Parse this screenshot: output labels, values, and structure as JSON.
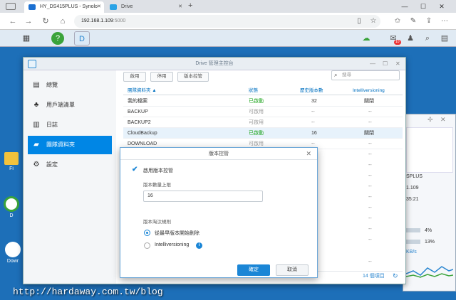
{
  "browser": {
    "tabs": [
      {
        "label": "HY_DS415PLUS - Synolo",
        "close": "✕"
      },
      {
        "label": "Drive",
        "close": "✕"
      }
    ],
    "new_tab": "+",
    "window_controls": {
      "minimize": "—",
      "maximize": "☐",
      "close": "✕"
    },
    "nav": {
      "back": "←",
      "forward": "→",
      "reload": "↻",
      "home": "⌂"
    },
    "url": {
      "host": "192.168.1.109",
      "port": ":5000"
    }
  },
  "dsm_taskbar": {
    "notification_count": "10"
  },
  "desktop_icons": [
    {
      "label": "Fi"
    },
    {
      "label": "D"
    },
    {
      "label": "Dowr"
    }
  ],
  "window": {
    "title": "Drive 管理主控台",
    "controls": {
      "minimize": "—",
      "maximize": "☐",
      "close": "✕"
    }
  },
  "sidebar": {
    "items": [
      {
        "label": "總覽",
        "icon": "overview-icon"
      },
      {
        "label": "用戶端清單",
        "icon": "client-list-icon"
      },
      {
        "label": "日誌",
        "icon": "log-icon"
      },
      {
        "label": "團隊資料夾",
        "icon": "team-folder-icon"
      },
      {
        "label": "設定",
        "icon": "settings-icon"
      }
    ],
    "active_index": 3
  },
  "toolbar": {
    "enable": "啟用",
    "disable": "停用",
    "versioning": "版本控管",
    "search_placeholder": "搜尋"
  },
  "table": {
    "headers": [
      "團隊資料夾 ▲",
      "狀態",
      "歷史版本數",
      "Intelliversioning"
    ],
    "rows": [
      {
        "name": "我的檔案",
        "status": "已啟動",
        "versions": "32",
        "intelli": "關閉"
      },
      {
        "name": "BACKUP",
        "status": "可啟用",
        "versions": "--",
        "intelli": "--"
      },
      {
        "name": "BACKUP2",
        "status": "可啟用",
        "versions": "--",
        "intelli": "--"
      },
      {
        "name": "CloudBackup",
        "status": "已啟動",
        "versions": "16",
        "intelli": "關閉"
      },
      {
        "name": "DOWNLOAD",
        "status": "可啟用",
        "versions": "--",
        "intelli": "--"
      }
    ],
    "extra_dashes": [
      "--",
      "--",
      "--",
      "--",
      "--",
      "--",
      "--",
      "--",
      "--",
      "--"
    ],
    "footer_count": "14 個項目",
    "refresh": "↻"
  },
  "widget": {
    "lines": [
      "SPLUS",
      "1.109",
      "35:21",
      "4%",
      "13%",
      "KB/s"
    ]
  },
  "modal": {
    "title": "版本控管",
    "close": "✕",
    "enable_label": "啟用版本控管",
    "max_versions_label": "版本數量上限",
    "max_versions_value": "16",
    "rotation_label": "版本淘汰規則",
    "option_oldest": "從最早版本開始刪除",
    "option_intelli": "Intelliversioning",
    "info": "i",
    "ok": "確定",
    "cancel": "取消"
  },
  "watermark": "http://hardaway.com.tw/blog",
  "colors": {
    "accent": "#0086e5",
    "enabled": "#1aa31a",
    "desktop": "#1d6fb8"
  }
}
